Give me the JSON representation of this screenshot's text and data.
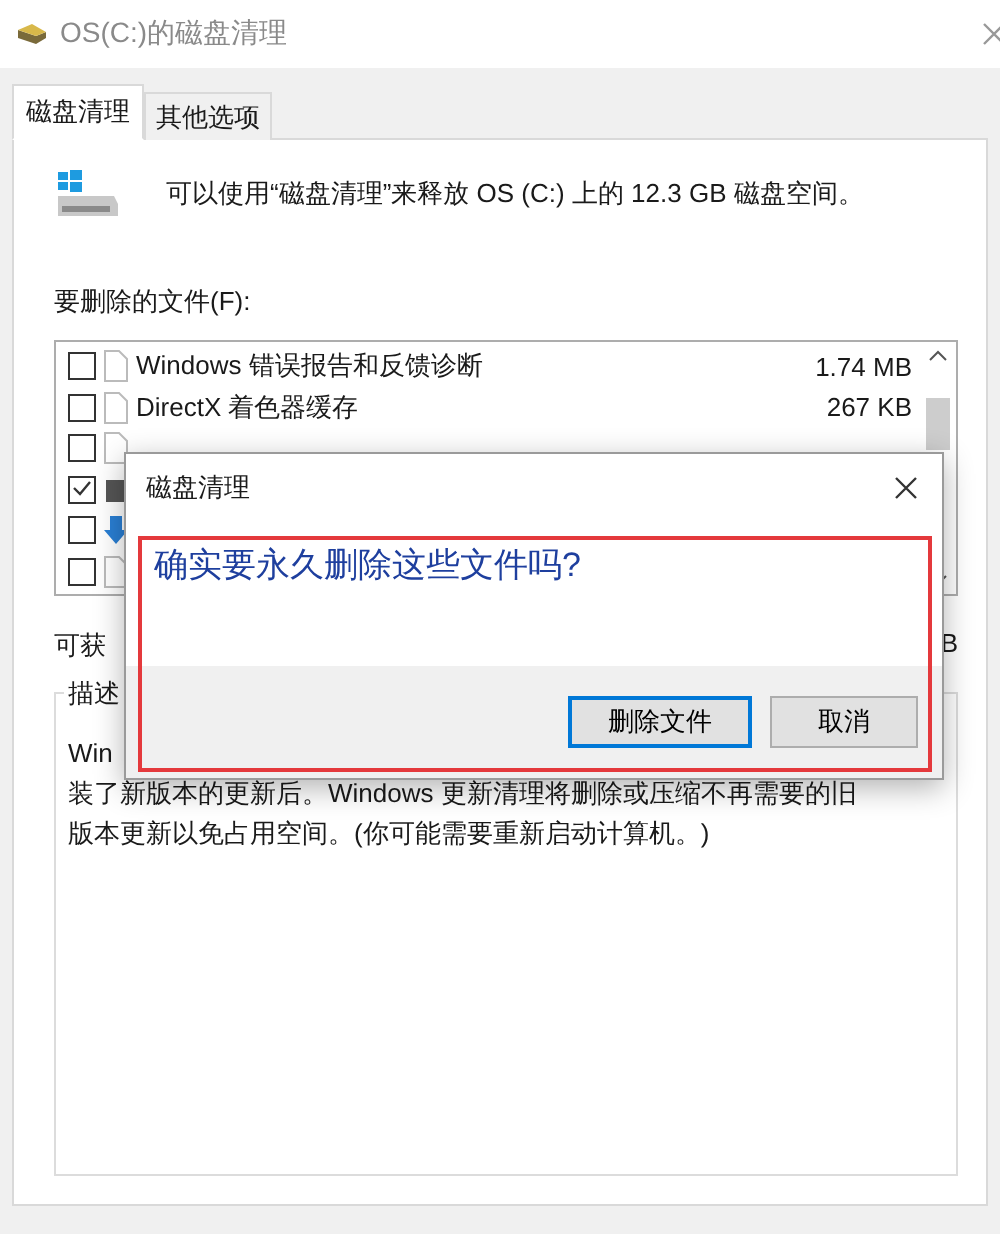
{
  "window": {
    "title": "OS(C:)的磁盘清理"
  },
  "tabs": [
    {
      "label": "磁盘清理",
      "selected": true
    },
    {
      "label": "其他选项",
      "selected": false
    }
  ],
  "summary": "可以使用“磁盘清理”来释放 OS (C:) 上的 12.3 GB 磁盘空间。",
  "files_label": "要删除的文件(F):",
  "files": [
    {
      "kind": "doc",
      "name": "Windows 错误报告和反馈诊断",
      "size": "1.74 MB",
      "checked": false
    },
    {
      "kind": "doc",
      "name": "DirectX 着色器缓存",
      "size": "267 KB",
      "checked": false
    },
    {
      "kind": "doc",
      "checked": false
    },
    {
      "kind": "drive",
      "checked": true
    },
    {
      "kind": "download",
      "checked": false
    },
    {
      "kind": "doc",
      "checked": false
    }
  ],
  "total": {
    "label": "可获",
    "value": "B"
  },
  "description": {
    "label": "描述",
    "lines": [
      "Win",
      "装了新版本的更新后。Windows 更新清理将删除或压缩不再需要的旧",
      "版本更新以免占用空间。(你可能需要重新启动计算机。)"
    ]
  },
  "dialog": {
    "title": "磁盘清理",
    "message": "确实要永久删除这些文件吗?",
    "annotated": true,
    "buttons": [
      {
        "label": "删除文件",
        "default": true
      },
      {
        "label": "取消",
        "default": false
      }
    ]
  }
}
